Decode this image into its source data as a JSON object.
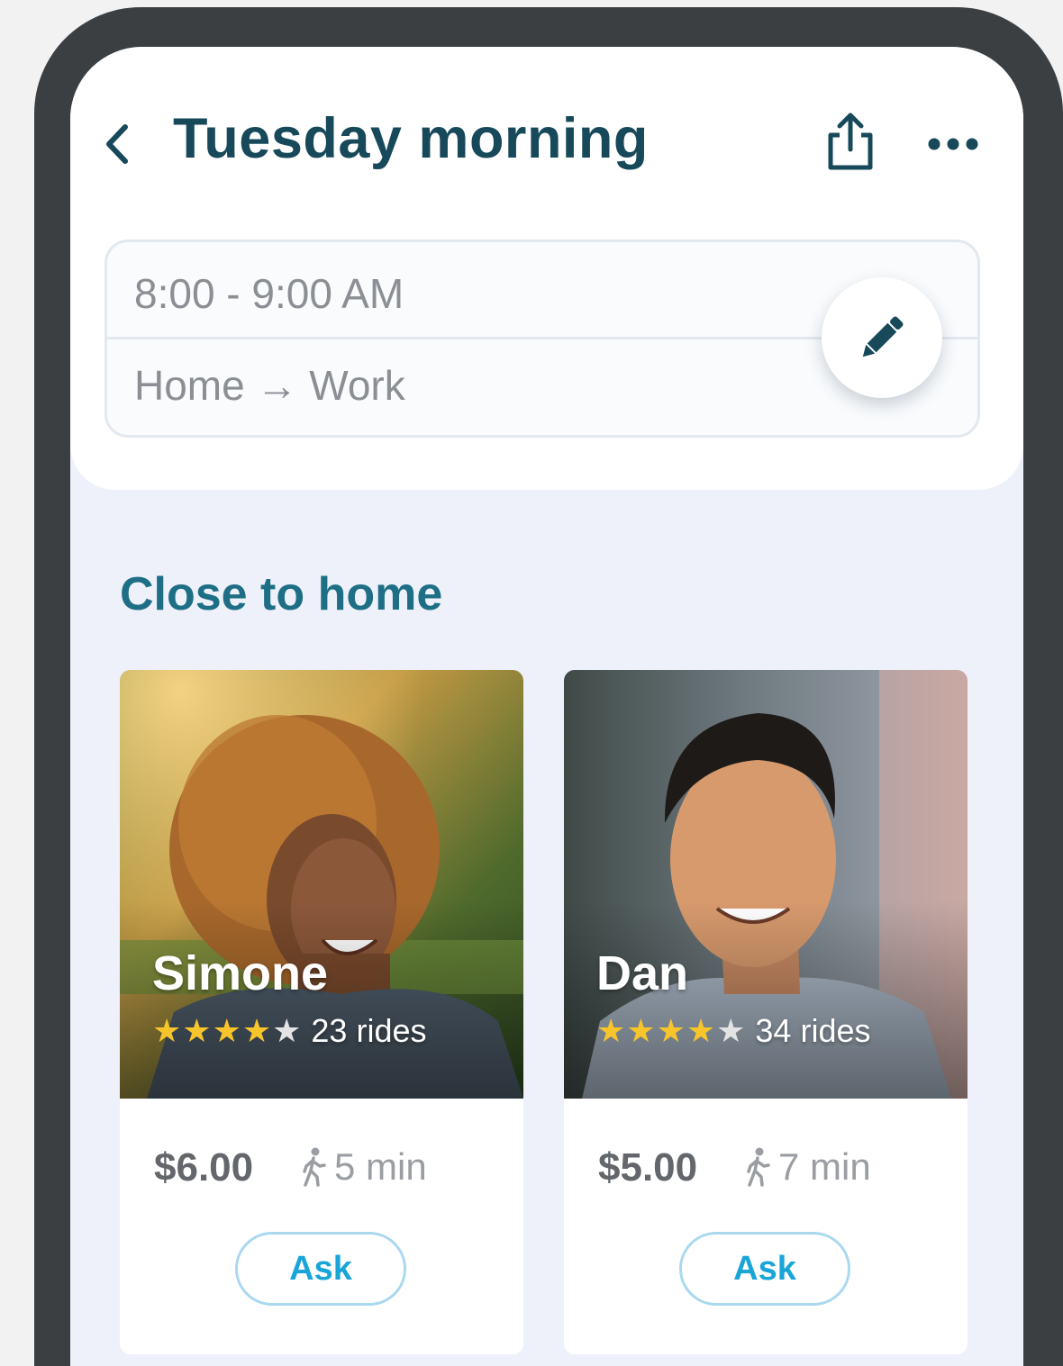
{
  "header": {
    "title": "Tuesday morning",
    "icons": {
      "back": "chevron-left-icon",
      "share": "share-icon",
      "more": "more-dots-icon"
    }
  },
  "trip": {
    "time": "8:00 - 9:00 AM",
    "route": "Home → Work",
    "edit_icon": "pencil-icon"
  },
  "section": {
    "title": "Close to home"
  },
  "drivers": [
    {
      "name": "Simone",
      "rating": 4.5,
      "rides": "23 rides",
      "price": "$6.00",
      "walk": "5 min",
      "ask_label": "Ask"
    },
    {
      "name": "Dan",
      "rating": 4.5,
      "rides": "34 rides",
      "price": "$5.00",
      "walk": "7 min",
      "ask_label": "Ask"
    }
  ],
  "colors": {
    "title": "#17495a",
    "section_title": "#1e6f86",
    "accent": "#1aa5d9",
    "star": "#f7c52b",
    "frame": "#3b3f42",
    "background": "#eef1f9"
  }
}
